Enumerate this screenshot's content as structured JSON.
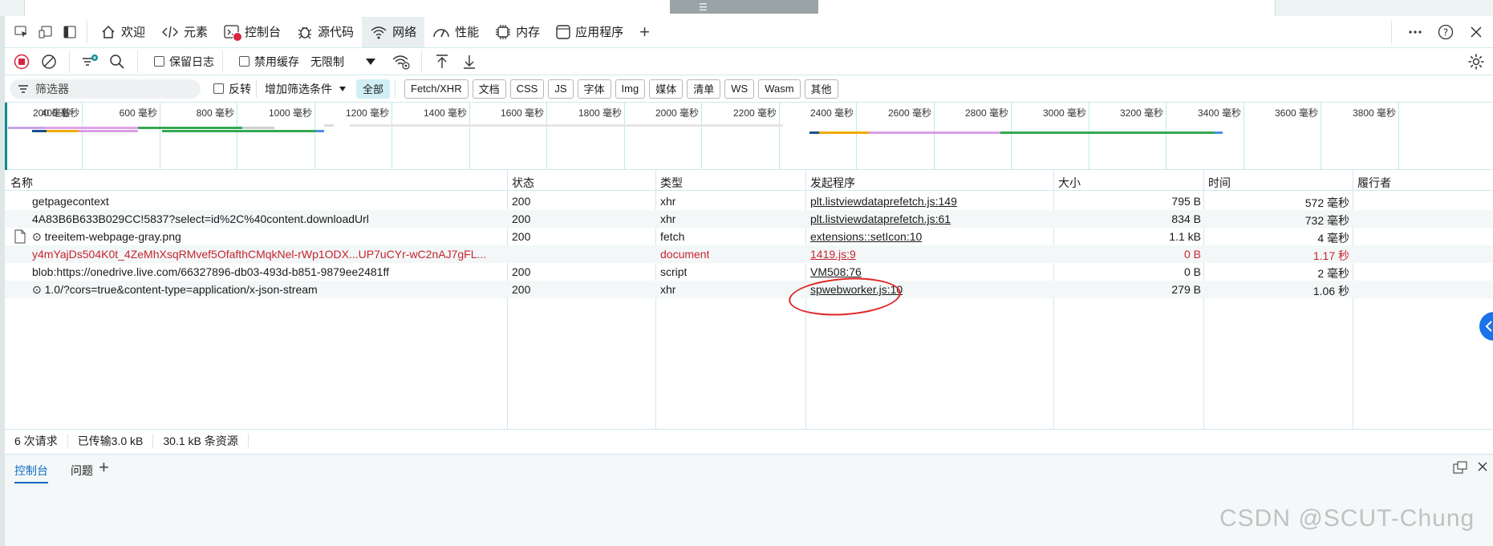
{
  "browser": {
    "drag_handle": "☰"
  },
  "tabs": [
    {
      "label": "欢迎",
      "icon": "home-icon"
    },
    {
      "label": "元素",
      "icon": "code-icon"
    },
    {
      "label": "控制台",
      "icon": "console-icon"
    },
    {
      "label": "源代码",
      "icon": "bug-icon"
    },
    {
      "label": "网络",
      "icon": "wifi-icon"
    },
    {
      "label": "性能",
      "icon": "gauge-icon"
    },
    {
      "label": "内存",
      "icon": "chip-icon"
    },
    {
      "label": "应用程序",
      "icon": "app-icon"
    }
  ],
  "toolbar": {
    "preserve_log": "保留日志",
    "disable_cache": "禁用缓存",
    "throttle": "无限制"
  },
  "filter": {
    "placeholder": "筛选器",
    "invert": "反转",
    "more_filters": "增加筛选条件",
    "types": [
      "全部",
      "Fetch/XHR",
      "文档",
      "CSS",
      "JS",
      "字体",
      "Img",
      "媒体",
      "清单",
      "WS",
      "Wasm",
      "其他"
    ]
  },
  "overview": {
    "ticks": [
      "200 毫秒",
      "400 毫秒",
      "600 毫秒",
      "800 毫秒",
      "1000 毫秒",
      "1200 毫秒",
      "1400 毫秒",
      "1600 毫秒",
      "1800 毫秒",
      "2000 毫秒",
      "2200 毫秒",
      "2400 毫秒",
      "2600 毫秒",
      "2800 毫秒",
      "3000 毫秒",
      "3200 毫秒",
      "3400 毫秒",
      "3600 毫秒",
      "3800 毫秒"
    ]
  },
  "table": {
    "headers": {
      "name": "名称",
      "status": "状态",
      "type": "类型",
      "initiator": "发起程序",
      "size": "大小",
      "time": "时间",
      "fulfilled": "履行者"
    },
    "rows": [
      {
        "name": "getpagecontext",
        "status": "200",
        "type": "xhr",
        "initiator": "plt.listviewdataprefetch.js:149",
        "size": "795 B",
        "time": "572 毫秒",
        "icon": "",
        "error": false
      },
      {
        "name": "4A83B6B633B029CC!5837?select=id%2C%40content.downloadUrl",
        "status": "200",
        "type": "xhr",
        "initiator": "plt.listviewdataprefetch.js:61",
        "size": "834 B",
        "time": "732 毫秒",
        "icon": "",
        "error": false
      },
      {
        "name": "⊙ treeitem-webpage-gray.png",
        "status": "200",
        "type": "fetch",
        "initiator": "extensions::setIcon:10",
        "size": "1.1 kB",
        "time": "4 毫秒",
        "icon": "file-icon",
        "error": false
      },
      {
        "name": "y4mYajDs504K0t_4ZeMhXsqRMvef5OfafthCMqkNel-rWp1ODX...UP7uCYr-wC2nAJ7gFL...",
        "status": "",
        "type": "document",
        "initiator": "1419.js:9",
        "size": "0 B",
        "time": "1.17 秒",
        "icon": "",
        "error": true
      },
      {
        "name": "blob:https://onedrive.live.com/66327896-db03-493d-b851-9879ee2481ff",
        "status": "200",
        "type": "script",
        "initiator": "VM508:76",
        "size": "0 B",
        "time": "2 毫秒",
        "icon": "",
        "error": false
      },
      {
        "name": "⊙ 1.0/?cors=true&content-type=application/x-json-stream",
        "status": "200",
        "type": "xhr",
        "initiator": "spwebworker.js:10",
        "size": "279 B",
        "time": "1.06 秒",
        "icon": "",
        "error": false
      }
    ]
  },
  "statusbar": {
    "requests": "6 次请求",
    "transferred": "已传输3.0 kB",
    "resources": "30.1 kB 条资源"
  },
  "drawer": {
    "console": "控制台",
    "issues": "问题"
  },
  "watermark": "CSDN @SCUT-Chung",
  "colors": {
    "accent": "#0f6cbd",
    "error": "#c5262f",
    "annotation": "#e32323"
  }
}
